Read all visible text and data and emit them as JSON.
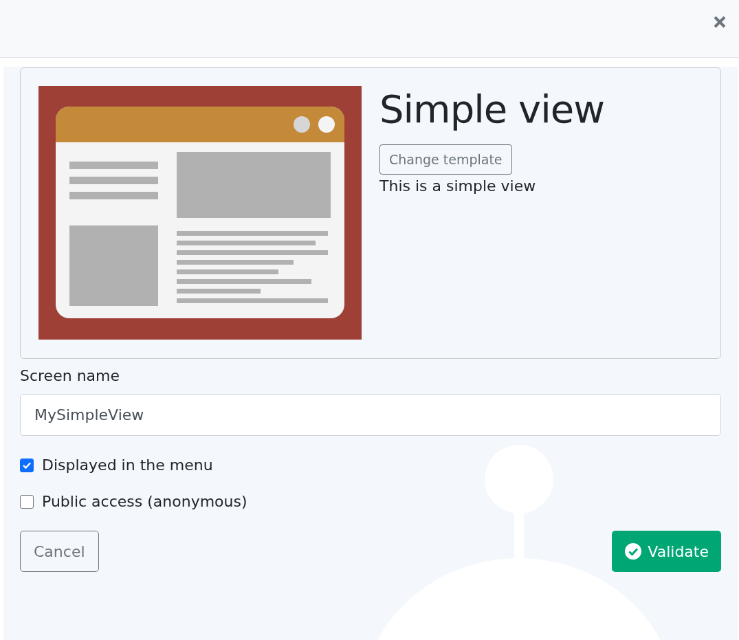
{
  "template": {
    "title": "Simple view",
    "change_button": "Change template",
    "description": "This is a simple view"
  },
  "screen_name": {
    "label": "Screen name",
    "value": "MySimpleView"
  },
  "options": [
    {
      "label": "Displayed in the menu",
      "checked": true
    },
    {
      "label": "Public access (anonymous)",
      "checked": false
    }
  ],
  "buttons": {
    "cancel": "Cancel",
    "validate": "Validate"
  }
}
